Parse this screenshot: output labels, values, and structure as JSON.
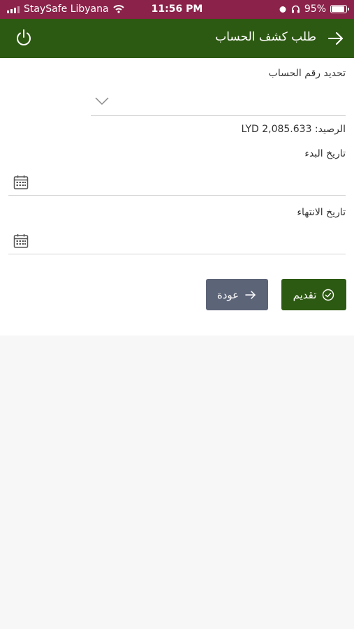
{
  "status_bar": {
    "carrier": "StaySafe Libyana",
    "time": "11:56 PM",
    "battery": "95%",
    "battery_level": 0.95
  },
  "header": {
    "title": "طلب كشف الحساب"
  },
  "form": {
    "account_label": "تحديد رقم الحساب",
    "balance_text": "الرصيد: LYD 2,085.633",
    "start_date_label": "تاريخ البدء",
    "end_date_label": "تاريخ الانتهاء"
  },
  "buttons": {
    "submit_label": "تقديم",
    "back_label": "عودة"
  },
  "colors": {
    "status_bar": "#8a2249",
    "brand_green": "#2d5a12",
    "back_button": "#5c6478"
  }
}
